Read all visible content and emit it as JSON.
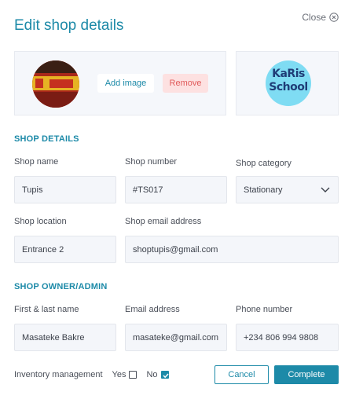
{
  "header": {
    "title": "Edit shop details",
    "close_label": "Close"
  },
  "image_panel": {
    "add_label": "Add image",
    "remove_label": "Remove",
    "logo_line1": "KaRis",
    "logo_line2": "School"
  },
  "shop_details": {
    "heading": "SHOP DETAILS",
    "shop_name": {
      "label": "Shop name",
      "value": "Tupis"
    },
    "shop_number": {
      "label": "Shop number",
      "value": "#TS017"
    },
    "shop_category": {
      "label": "Shop category",
      "value": "Stationary"
    },
    "shop_location": {
      "label": "Shop location",
      "value": "Entrance 2"
    },
    "shop_email": {
      "label": "Shop email address",
      "value": "shoptupis@gmail.com"
    }
  },
  "owner": {
    "heading": "SHOP OWNER/ADMIN",
    "name": {
      "label": "First & last name",
      "value": "Masateke Bakre"
    },
    "email": {
      "label": "Email address",
      "value": "masateke@gmail.com"
    },
    "phone": {
      "label": "Phone number",
      "value": "+234 806 994 9808"
    }
  },
  "footer": {
    "inventory_label": "Inventory management",
    "yes_label": "Yes",
    "no_label": "No",
    "inventory_yes_checked": false,
    "inventory_no_checked": true,
    "cancel_label": "Cancel",
    "complete_label": "Complete"
  },
  "colors": {
    "accent": "#1d8aa8",
    "danger_bg": "#fde1e1",
    "danger_text": "#e05b5b",
    "logo_bg": "#7fdcf3",
    "logo_text": "#1f3d77"
  },
  "icons": {
    "close": "close-circle-icon",
    "select": "chevron-down-icon",
    "check": "checkmark-icon"
  }
}
